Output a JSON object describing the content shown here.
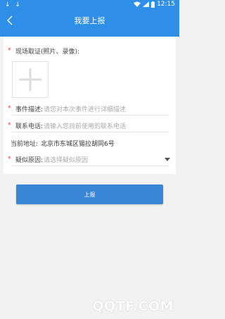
{
  "status_bar": {
    "left_icons": "↓ ↓",
    "time": "12:15",
    "icons": [
      "wifi-icon",
      "signal-icon",
      "battery-icon"
    ]
  },
  "nav": {
    "title": "我要上报"
  },
  "form": {
    "evidence_label": "现场取证(照片、录像):",
    "event_label": "事件描述:",
    "event_placeholder": "请您对本次事件进行详细描述",
    "phone_label": "联系电话:",
    "phone_placeholder": "请输入您目前使用的联系电话",
    "address_label": "当前地址:",
    "address_value": "北京市东城区锡拉胡同6号",
    "reason_label": "疑似原因:",
    "reason_placeholder": "请选择疑似原因",
    "required_mark": "*"
  },
  "submit_label": "上报",
  "watermark": "QQTF.COM",
  "colors": {
    "header": "#2f8ee8",
    "button": "#3a86d6",
    "required": "#e53935"
  }
}
